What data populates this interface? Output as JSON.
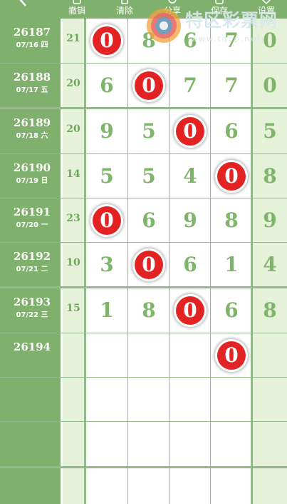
{
  "toolbar": {
    "back_icon": "chevron-left-icon",
    "buttons": [
      {
        "label": "撤销",
        "icon": "undo-icon"
      },
      {
        "label": "清除",
        "icon": "trash-icon"
      },
      {
        "label": "分享",
        "icon": "share-icon"
      },
      {
        "label": "保存",
        "icon": "save-icon"
      },
      {
        "label": "设置",
        "icon": "gear-icon"
      }
    ]
  },
  "watermark": {
    "brand_text": "特区彩票网",
    "url_text": "www.tqcp.net"
  },
  "colors": {
    "issue_column": "#7fb06e",
    "side_column": "#e5f1d8",
    "grid_line": "#93b98a",
    "digit_text": "#7fb56a",
    "zero_marker": "#e32323"
  },
  "rows": [
    {
      "issue": "26187",
      "date": "07/16 四",
      "sum": "21",
      "digits": [
        "0",
        "8",
        "6",
        "7"
      ],
      "tail": "0",
      "zero_index": 0
    },
    {
      "issue": "26188",
      "date": "07/17 五",
      "sum": "20",
      "digits": [
        "6",
        "0",
        "7",
        "7"
      ],
      "tail": "0",
      "zero_index": 1
    },
    {
      "issue": "26189",
      "date": "07/18 六",
      "sum": "20",
      "digits": [
        "9",
        "5",
        "0",
        "6"
      ],
      "tail": "5",
      "zero_index": 2
    },
    {
      "issue": "26190",
      "date": "07/19 日",
      "sum": "14",
      "digits": [
        "5",
        "5",
        "4",
        "0"
      ],
      "tail": "8",
      "zero_index": 3
    },
    {
      "issue": "26191",
      "date": "07/20 一",
      "sum": "23",
      "digits": [
        "0",
        "6",
        "9",
        "8"
      ],
      "tail": "9",
      "zero_index": 0
    },
    {
      "issue": "26192",
      "date": "07/21 二",
      "sum": "10",
      "digits": [
        "3",
        "0",
        "6",
        "1"
      ],
      "tail": "4",
      "zero_index": 1
    },
    {
      "issue": "26193",
      "date": "07/22 三",
      "sum": "15",
      "digits": [
        "1",
        "8",
        "0",
        "6"
      ],
      "tail": "8",
      "zero_index": 2
    },
    {
      "issue": "26194",
      "date": "",
      "sum": "",
      "digits": [
        "",
        "",
        "",
        "0"
      ],
      "tail": "",
      "zero_index": 3
    },
    {
      "issue": "",
      "date": "",
      "sum": "",
      "digits": [
        "",
        "",
        "",
        ""
      ],
      "tail": "",
      "zero_index": -1
    },
    {
      "issue": "",
      "date": "",
      "sum": "",
      "digits": [
        "",
        "",
        "",
        ""
      ],
      "tail": "",
      "zero_index": -1
    },
    {
      "issue": "",
      "date": "",
      "sum": "",
      "digits": [
        "",
        "",
        "",
        ""
      ],
      "tail": "",
      "zero_index": -1
    }
  ]
}
